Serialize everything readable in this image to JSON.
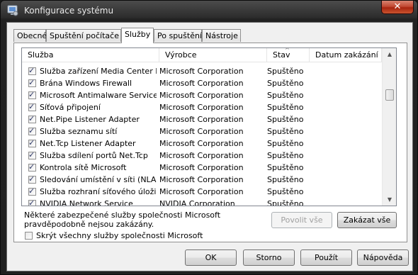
{
  "window": {
    "title": "Konfigurace systému",
    "close_glyph": "✕",
    "title_icon": "msconfig-icon"
  },
  "tabs": [
    {
      "label": "Obecné",
      "active": false
    },
    {
      "label": "Spuštění počítače",
      "active": false
    },
    {
      "label": "Služby",
      "active": true
    },
    {
      "label": "Po spuštění",
      "active": false
    },
    {
      "label": "Nástroje",
      "active": false
    }
  ],
  "services": {
    "columns": {
      "service": "Služba",
      "manufacturer": "Výrobce",
      "status": "Stav",
      "date_disabled": "Datum zakázání"
    },
    "sort_column": "status",
    "sort_glyph": "^",
    "rows": [
      {
        "checked": true,
        "name": "Služba zařízení Media Center Ext...",
        "manufacturer": "Microsoft Corporation",
        "status": "Spuštěno",
        "date": ""
      },
      {
        "checked": true,
        "name": "Brána Windows Firewall",
        "manufacturer": "Microsoft Corporation",
        "status": "Spuštěno",
        "date": ""
      },
      {
        "checked": true,
        "name": "Microsoft Antimalware Service",
        "manufacturer": "Microsoft Corporation",
        "status": "Spuštěno",
        "date": ""
      },
      {
        "checked": true,
        "name": "Síťová připojení",
        "manufacturer": "Microsoft Corporation",
        "status": "Spuštěno",
        "date": ""
      },
      {
        "checked": true,
        "name": "Net.Pipe Listener Adapter",
        "manufacturer": "Microsoft Corporation",
        "status": "Spuštěno",
        "date": ""
      },
      {
        "checked": true,
        "name": "Služba seznamu sítí",
        "manufacturer": "Microsoft Corporation",
        "status": "Spuštěno",
        "date": ""
      },
      {
        "checked": true,
        "name": "Net.Tcp Listener Adapter",
        "manufacturer": "Microsoft Corporation",
        "status": "Spuštěno",
        "date": ""
      },
      {
        "checked": true,
        "name": "Služba sdílení portů Net.Tcp",
        "manufacturer": "Microsoft Corporation",
        "status": "Spuštěno",
        "date": ""
      },
      {
        "checked": true,
        "name": "Kontrola sítě Microsoft",
        "manufacturer": "Microsoft Corporation",
        "status": "Spuštěno",
        "date": ""
      },
      {
        "checked": true,
        "name": "Sledování umístění v síti (NLA)",
        "manufacturer": "Microsoft Corporation",
        "status": "Spuštěno",
        "date": ""
      },
      {
        "checked": true,
        "name": "Služba rozhraní síťového úložiště",
        "manufacturer": "Microsoft Corporation",
        "status": "Spuštěno",
        "date": ""
      },
      {
        "checked": true,
        "name": "NVIDIA Network Service",
        "manufacturer": "NVIDIA Corporation",
        "status": "Spuštěno",
        "date": ""
      }
    ],
    "scroll_up_glyph": "▲",
    "scroll_down_glyph": "▼"
  },
  "note": "Některé zabezpečené služby společnosti Microsoft pravděpodobně nejsou zakázány.",
  "buttons": {
    "enable_all": "Povolit vše",
    "disable_all": "Zakázat vše",
    "ok": "OK",
    "cancel": "Storno",
    "apply": "Použít",
    "help": "Nápověda"
  },
  "hide_microsoft": {
    "label": "Skrýt všechny služby společnosti Microsoft",
    "checked": false
  },
  "tick_glyph": "✓"
}
